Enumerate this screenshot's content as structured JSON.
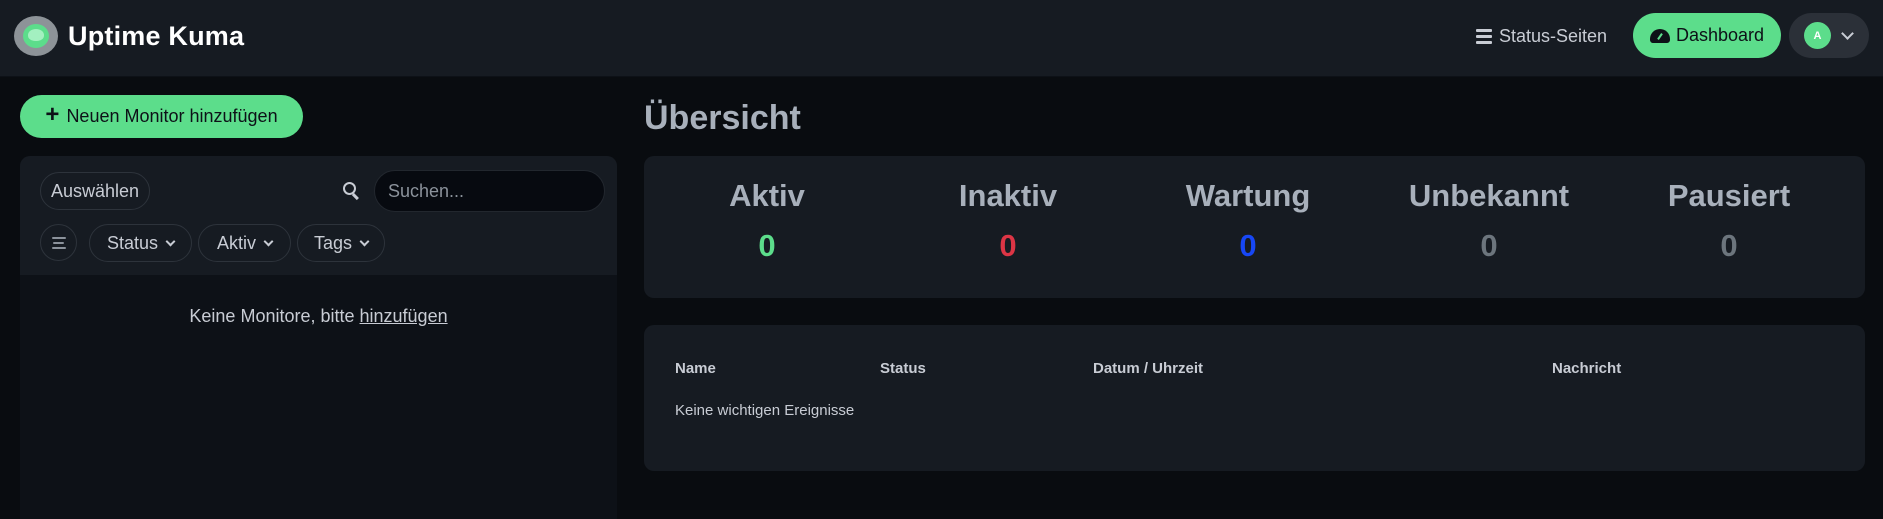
{
  "header": {
    "brand_title": "Uptime Kuma",
    "status_pages_label": "Status-Seiten",
    "dashboard_label": "Dashboard",
    "avatar_initial": "A"
  },
  "sidebar": {
    "add_monitor_label": "Neuen Monitor hinzufügen",
    "select_label": "Auswählen",
    "search_placeholder": "Suchen...",
    "filters": [
      {
        "label": "Status"
      },
      {
        "label": "Aktiv"
      },
      {
        "label": "Tags"
      }
    ],
    "empty_text": "Keine Monitore, bitte",
    "empty_link": "hinzufügen"
  },
  "main": {
    "title": "Übersicht",
    "stats": [
      {
        "label": "Aktiv",
        "value": "0",
        "color": "#5cdd8b"
      },
      {
        "label": "Inaktiv",
        "value": "0",
        "color": "#dc3545"
      },
      {
        "label": "Wartung",
        "value": "0",
        "color": "#1747f5"
      },
      {
        "label": "Unbekannt",
        "value": "0",
        "color": "#6c757d"
      },
      {
        "label": "Pausiert",
        "value": "0",
        "color": "#6c757d"
      }
    ],
    "events": {
      "columns": [
        "Name",
        "Status",
        "Datum / Uhrzeit",
        "Nachricht"
      ],
      "empty_text": "Keine wichtigen Ereignisse"
    }
  },
  "colors": {
    "accent": "#5cdd8b",
    "header_bg": "#161b22",
    "page_bg": "#090c10"
  }
}
